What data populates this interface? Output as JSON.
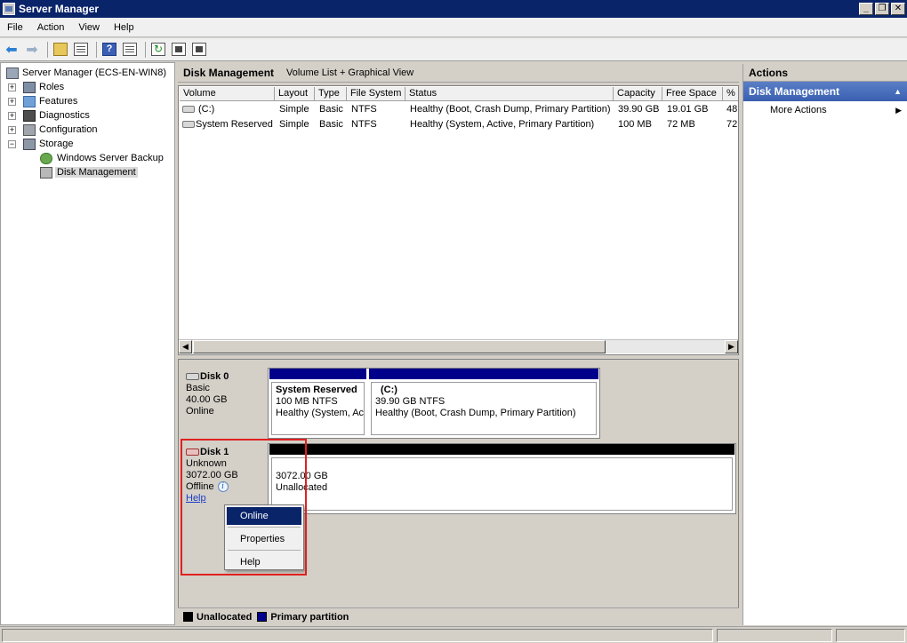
{
  "window": {
    "title": "Server Manager",
    "min": "_",
    "restore": "❐",
    "close": "✕"
  },
  "menu": [
    "File",
    "Action",
    "View",
    "Help"
  ],
  "tree": {
    "root": "Server Manager (ECS-EN-WIN8)",
    "roles": "Roles",
    "features": "Features",
    "diagnostics": "Diagnostics",
    "configuration": "Configuration",
    "storage": "Storage",
    "backup": "Windows Server Backup",
    "disk_management": "Disk Management"
  },
  "center": {
    "title": "Disk Management",
    "subtitle": "Volume List + Graphical View"
  },
  "volume_table": {
    "columns": [
      "Volume",
      "Layout",
      "Type",
      "File System",
      "Status",
      "Capacity",
      "Free Space",
      "%"
    ],
    "rows": [
      [
        "(C:)",
        "Simple",
        "Basic",
        "NTFS",
        "Healthy (Boot, Crash Dump, Primary Partition)",
        "39.90 GB",
        "19.01 GB",
        "48"
      ],
      [
        "System Reserved",
        "Simple",
        "Basic",
        "NTFS",
        "Healthy (System, Active, Primary Partition)",
        "100 MB",
        "72 MB",
        "72"
      ]
    ]
  },
  "disk0": {
    "name": "Disk 0",
    "type": "Basic",
    "size": "40.00 GB",
    "status": "Online",
    "part1": {
      "name": "System Reserved",
      "size": "100 MB NTFS",
      "status": "Healthy (System, Ac"
    },
    "part2": {
      "name": "(C:)",
      "size": "39.90 GB NTFS",
      "status": "Healthy (Boot, Crash Dump, Primary Partition)"
    }
  },
  "disk1": {
    "name": "Disk 1",
    "type": "Unknown",
    "size": "3072.00 GB",
    "status": "Offline",
    "help": "Help",
    "part1": {
      "size": "3072.00 GB",
      "status": "Unallocated"
    }
  },
  "context_menu": {
    "online": "Online",
    "properties": "Properties",
    "help": "Help"
  },
  "legend": {
    "unallocated": "Unallocated",
    "primary": "Primary partition"
  },
  "actions": {
    "header": "Actions",
    "section": "Disk Management",
    "more": "More Actions"
  },
  "colors": {
    "primary": "#00008b",
    "unallocated": "#000000",
    "highlight": "#0a246a",
    "annotation": "#e02020"
  }
}
